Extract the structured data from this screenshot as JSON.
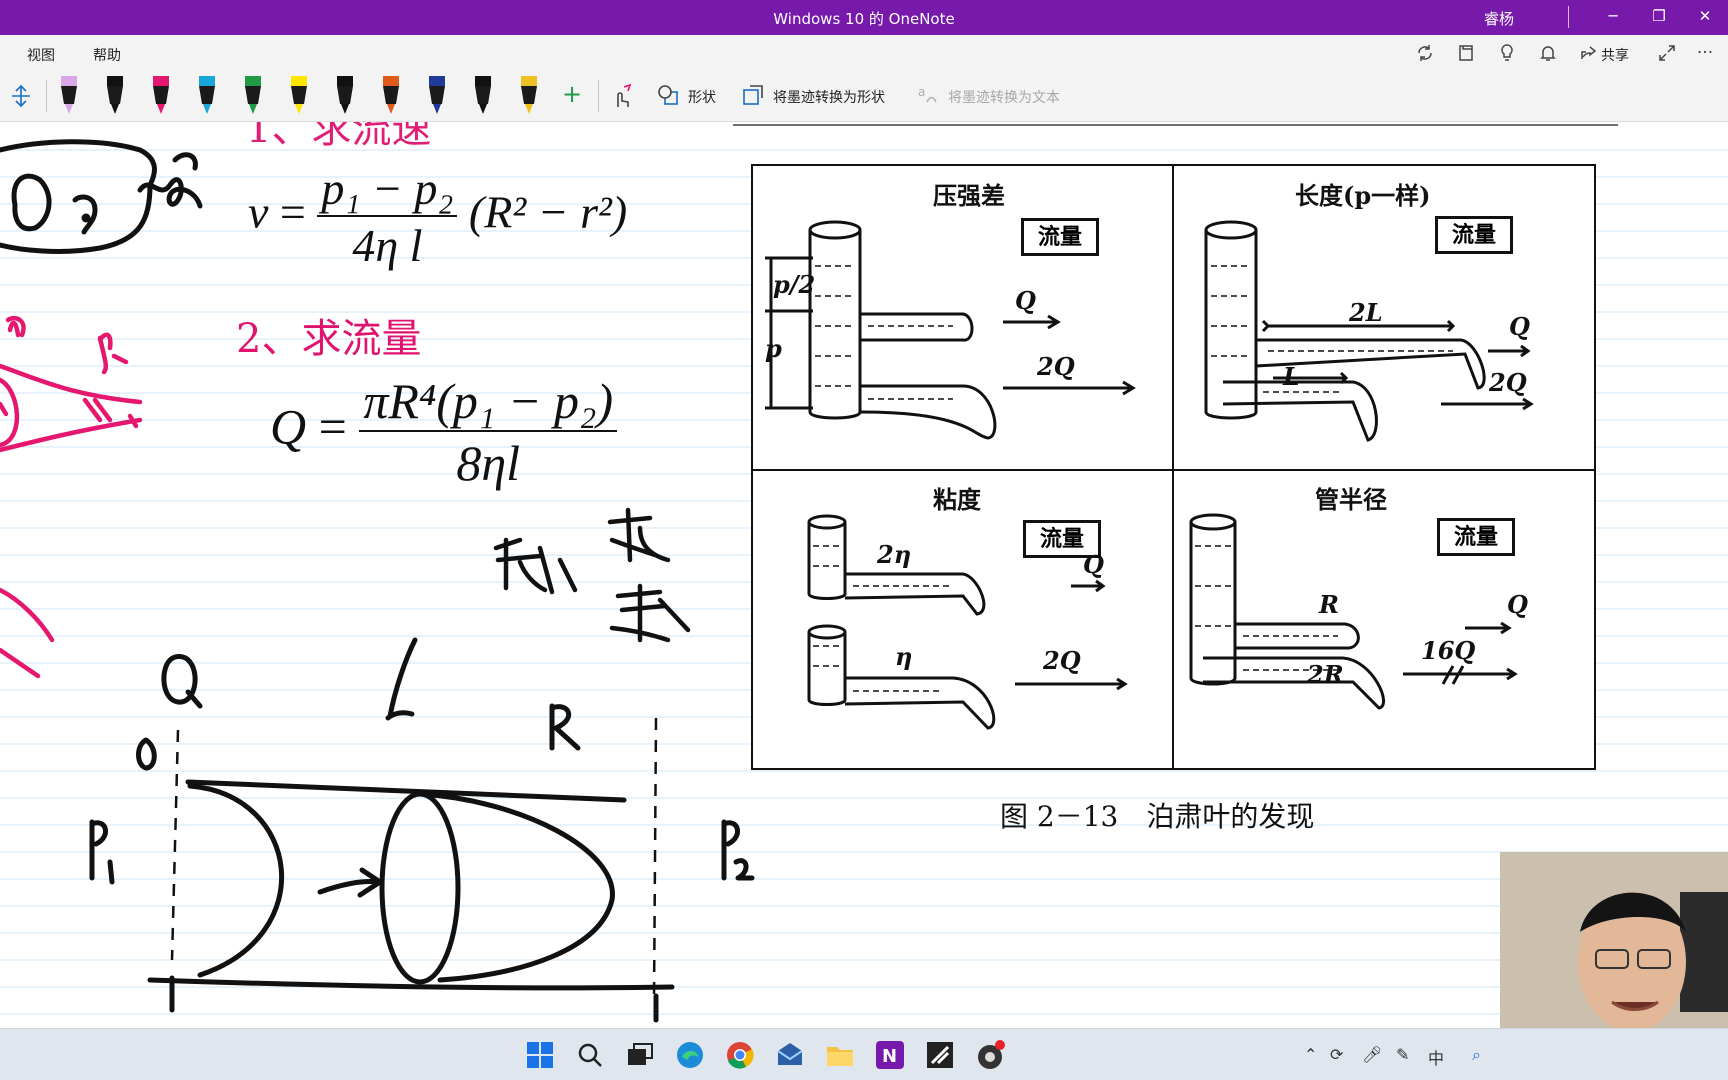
{
  "window": {
    "title": "Windows 10 的 OneNote",
    "user": "睿杨",
    "minimize": "─",
    "restore": "❐",
    "close": "✕"
  },
  "menu": {
    "items": [
      "视图",
      "帮助"
    ],
    "share_label": "共享",
    "more": "···"
  },
  "toolbar": {
    "shapes_label": "形状",
    "ink_to_shape_label": "将墨迹转换为形状",
    "ink_to_text_label": "将墨迹转换为文本",
    "add_pen": "+",
    "pens": [
      {
        "color": "#d9a6e8"
      },
      {
        "color": "#111111"
      },
      {
        "color": "#e6176e"
      },
      {
        "color": "#1aa6d9"
      },
      {
        "color": "#1f9a45"
      },
      {
        "color": "#ffe600"
      },
      {
        "color": "#111111"
      },
      {
        "color": "#e05a1c"
      },
      {
        "color": "#1f3a9a"
      },
      {
        "color": "#111111"
      },
      {
        "color": "#f0c020"
      }
    ]
  },
  "note": {
    "heading_1_partial": "1、求流速",
    "formula_v": {
      "lhs": "v",
      "num": "p₁ − p₂",
      "den": "4η l",
      "tail": "(R² − r²)"
    },
    "heading_2": "2、求流量",
    "formula_q": {
      "lhs": "Q",
      "num": "πR⁴(p₁ − p₂)",
      "den": "8ηl"
    },
    "hw_macro": "宏观",
    "hw_experiment": "实验",
    "hw_law": "定律",
    "hw_Q": "Q",
    "hw_l": "l",
    "hw_R": "R",
    "hw_zero": "0",
    "hw_P1": "P₁",
    "hw_P2": "P₂",
    "hw_p1_pink": "P₁",
    "hw_p2_pink": "P₂"
  },
  "figure": {
    "panels": [
      {
        "title": "压强差",
        "flow": "流量",
        "labels": [
          "p/2",
          "p",
          "Q",
          "2Q"
        ]
      },
      {
        "title": "长度(p一样)",
        "flow": "流量",
        "labels": [
          "2L",
          "L",
          "Q",
          "2Q"
        ]
      },
      {
        "title": "粘度",
        "flow": "流量",
        "labels": [
          "2η",
          "η",
          "Q",
          "2Q"
        ]
      },
      {
        "title": "管半径",
        "flow": "流量",
        "labels": [
          "R",
          "2R",
          "Q",
          "16Q"
        ]
      }
    ],
    "caption": "图 2－13　泊肃叶的发现"
  },
  "colors": {
    "title_bar": "#7719aa",
    "pink_ink": "#e6176e",
    "taskbar": "#dfe6ee"
  }
}
